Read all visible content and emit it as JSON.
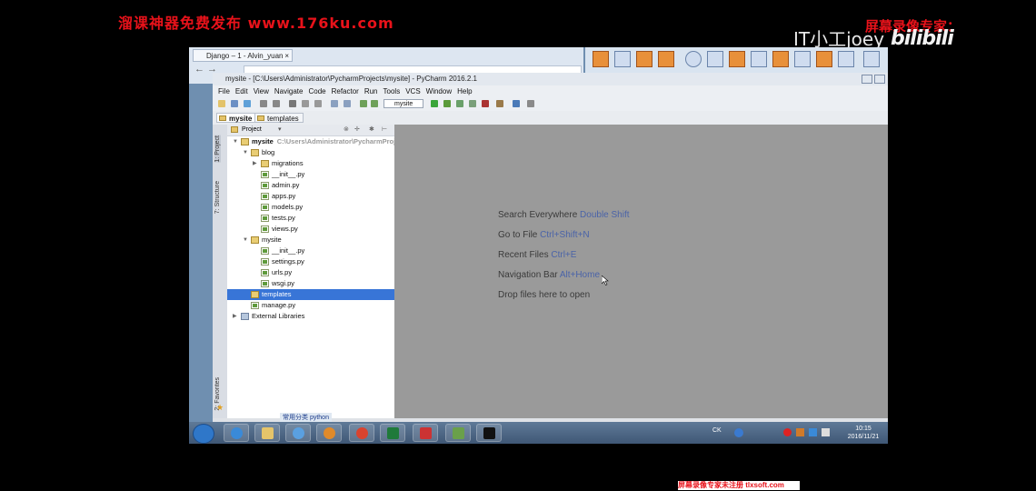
{
  "overlay": {
    "top_watermark": "溜课神器免费发布 www.176ku.com",
    "right_watermark": "屏幕录像专家：",
    "uploader": "IT小工joey",
    "platform_logo": "bilibili",
    "bottom_watermark": "屏幕录像专家未注册 tlxsoft.com"
  },
  "browser": {
    "tab_title": "Django – 1 - Alvin_yuan",
    "tab_close": "×"
  },
  "pycharm": {
    "title": "mysite - [C:\\Users\\Administrator\\PycharmProjects\\mysite] - PyCharm 2016.2.1",
    "menu": [
      "File",
      "Edit",
      "View",
      "Navigate",
      "Code",
      "Refactor",
      "Run",
      "Tools",
      "VCS",
      "Window",
      "Help"
    ],
    "run_config": "mysite",
    "breadcrumbs": [
      "mysite",
      "templates"
    ],
    "left_tabs": [
      "1: Project",
      "7: Structure",
      "2: Favorites"
    ],
    "project_header": "Project",
    "tree": [
      {
        "label": "mysite",
        "path": "C:\\Users\\Administrator\\PycharmProjects",
        "icon": "folder-icon",
        "level": 0,
        "expanded": true,
        "bold": true
      },
      {
        "label": "blog",
        "icon": "package-icon",
        "level": 1,
        "expanded": true
      },
      {
        "label": "migrations",
        "icon": "package-icon",
        "level": 2,
        "expanded": false
      },
      {
        "label": "__init__.py",
        "icon": "python-file-icon",
        "level": 2
      },
      {
        "label": "admin.py",
        "icon": "python-file-icon",
        "level": 2
      },
      {
        "label": "apps.py",
        "icon": "python-file-icon",
        "level": 2
      },
      {
        "label": "models.py",
        "icon": "python-file-icon",
        "level": 2
      },
      {
        "label": "tests.py",
        "icon": "python-file-icon",
        "level": 2
      },
      {
        "label": "views.py",
        "icon": "python-file-icon",
        "level": 2
      },
      {
        "label": "mysite",
        "icon": "package-icon",
        "level": 1,
        "expanded": true
      },
      {
        "label": "__init__.py",
        "icon": "python-file-icon",
        "level": 2
      },
      {
        "label": "settings.py",
        "icon": "python-file-icon",
        "level": 2
      },
      {
        "label": "urls.py",
        "icon": "python-file-icon",
        "level": 2
      },
      {
        "label": "wsgi.py",
        "icon": "python-file-icon",
        "level": 2
      },
      {
        "label": "templates",
        "icon": "folder-icon",
        "level": 1,
        "selected": true
      },
      {
        "label": "manage.py",
        "icon": "python-file-icon",
        "level": 1
      },
      {
        "label": "External Libraries",
        "icon": "library-icon",
        "level": 0,
        "expanded": false
      }
    ],
    "editor_hints": [
      {
        "text": "Search Everywhere",
        "key": "Double Shift"
      },
      {
        "text": "Go to File",
        "key": "Ctrl+Shift+N"
      },
      {
        "text": "Recent Files",
        "key": "Ctrl+E"
      },
      {
        "text": "Navigation Bar",
        "key": "Alt+Home"
      },
      {
        "text": "Drop files here to open",
        "key": ""
      }
    ]
  },
  "taskbar": {
    "tooltip": "常用分类 python",
    "tray_lang": "CK",
    "clock_time": "10:15",
    "clock_date": "2016/11/21"
  }
}
